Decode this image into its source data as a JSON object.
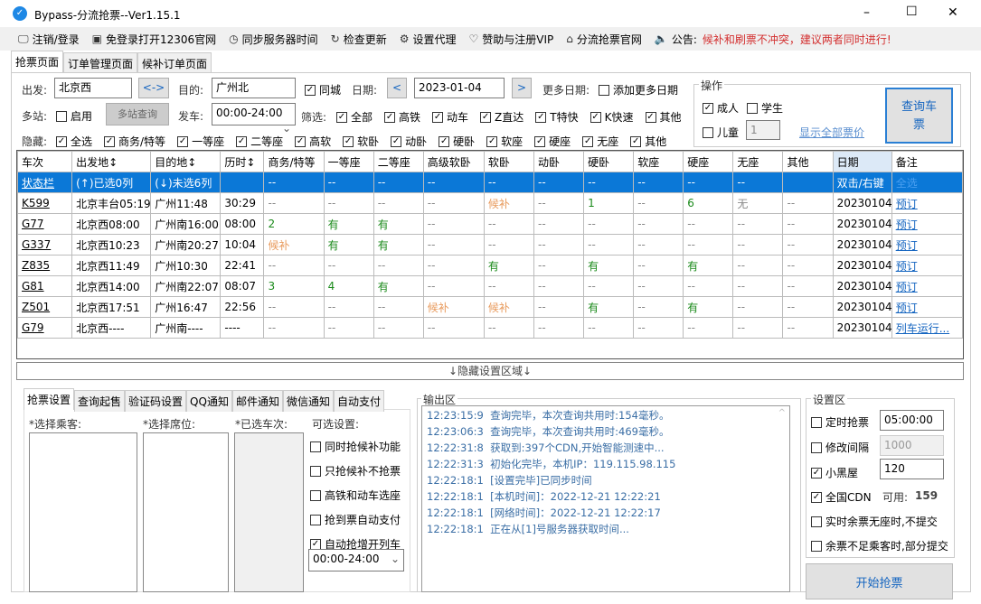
{
  "window": {
    "title": "Bypass-分流抢票--Ver1.15.1",
    "minimize": "–",
    "maximize": "☐",
    "close": "✕"
  },
  "menu": [
    {
      "icon": "monitor-icon",
      "glyph": "🖵",
      "label": "注销/登录"
    },
    {
      "icon": "browser-icon",
      "glyph": "▣",
      "label": "免登录打开12306官网"
    },
    {
      "icon": "clock-icon",
      "glyph": "◷",
      "label": "同步服务器时间"
    },
    {
      "icon": "refresh-icon",
      "glyph": "↻",
      "label": "检查更新"
    },
    {
      "icon": "gear-icon",
      "glyph": "⚙",
      "label": "设置代理"
    },
    {
      "icon": "heart-icon",
      "glyph": "♡",
      "label": "赞助与注册VIP"
    },
    {
      "icon": "home-icon",
      "glyph": "⌂",
      "label": "分流抢票官网"
    },
    {
      "icon": "speaker-icon",
      "glyph": "🔈",
      "label": "公告:"
    }
  ],
  "notice": "候补和刷票不冲突，建议两者同时进行!",
  "tabs": [
    "抢票页面",
    "订单管理页面",
    "候补订单页面"
  ],
  "search": {
    "from_label": "出发:",
    "from": "北京西",
    "swap": "<->",
    "to_label": "目的:",
    "to": "广州北",
    "same_city": "同城",
    "date_label": "日期:",
    "prev": "<",
    "date": "2023-01-04",
    "next": ">",
    "more_dates_label": "更多日期:",
    "add_dates": "添加更多日期",
    "multi_label": "多站:",
    "enable": "启用",
    "multi_query": "多站查询",
    "depart_label": "发车:",
    "depart_time": "00:00-24:00",
    "filter_label": "筛选:",
    "filters": [
      "全部",
      "高铁",
      "动车",
      "Z直达",
      "T特快",
      "K快速",
      "其他"
    ],
    "hide_label": "隐藏:",
    "hides": [
      "全选",
      "商务/特等",
      "一等座",
      "二等座",
      "高软",
      "软卧",
      "动卧",
      "硬卧",
      "软座",
      "硬座",
      "无座",
      "其他"
    ]
  },
  "ops": {
    "title": "操作",
    "adult": "成人",
    "student": "学生",
    "child": "儿童",
    "child_count": "1",
    "show_prices": "显示全部票价",
    "query": "查询车票"
  },
  "table": {
    "headers": [
      "车次",
      "出发地↕",
      "目的地↕",
      "历时↕",
      "商务/特等",
      "一等座",
      "二等座",
      "高级软卧",
      "软卧",
      "动卧",
      "硬卧",
      "软座",
      "硬座",
      "无座",
      "其他",
      "日期",
      "备注"
    ],
    "status_row": [
      "状态栏",
      "(↑)已选0列",
      "(↓)未选6列",
      "",
      "--",
      "--",
      "--",
      "--",
      "--",
      "--",
      "--",
      "--",
      "--",
      "--",
      "",
      "双击/右键",
      "全选"
    ],
    "rows": [
      [
        "K599",
        "北京丰台05:19",
        "广州11:48",
        "30:29",
        "--",
        "--",
        "--",
        "--",
        "候补",
        "--",
        "1",
        "--",
        "6",
        "无",
        "--",
        "20230104",
        "预订"
      ],
      [
        "G77",
        "北京西08:00",
        "广州南16:00",
        "08:00",
        "2",
        "有",
        "有",
        "--",
        "--",
        "--",
        "--",
        "--",
        "--",
        "--",
        "--",
        "20230104",
        "预订"
      ],
      [
        "G337",
        "北京西10:23",
        "广州南20:27",
        "10:04",
        "候补",
        "有",
        "有",
        "--",
        "--",
        "--",
        "--",
        "--",
        "--",
        "--",
        "--",
        "20230104",
        "预订"
      ],
      [
        "Z835",
        "北京西11:49",
        "广州10:30",
        "22:41",
        "--",
        "--",
        "--",
        "--",
        "有",
        "--",
        "有",
        "--",
        "有",
        "--",
        "--",
        "20230104",
        "预订"
      ],
      [
        "G81",
        "北京西14:00",
        "广州南22:07",
        "08:07",
        "3",
        "4",
        "有",
        "--",
        "--",
        "--",
        "--",
        "--",
        "--",
        "--",
        "--",
        "20230104",
        "预订"
      ],
      [
        "Z501",
        "北京西17:51",
        "广州16:47",
        "22:56",
        "--",
        "--",
        "--",
        "候补",
        "候补",
        "--",
        "有",
        "--",
        "有",
        "--",
        "--",
        "20230104",
        "预订"
      ],
      [
        "G79",
        "北京西----",
        "广州南----",
        "----",
        "--",
        "--",
        "--",
        "--",
        "--",
        "--",
        "--",
        "--",
        "--",
        "--",
        "--",
        "20230104",
        "列车运行..."
      ]
    ]
  },
  "hide_settings": "↓隐藏设置区域↓",
  "bottom_tabs": [
    "抢票设置",
    "查询起售",
    "验证码设置",
    "QQ通知",
    "邮件通知",
    "微信通知",
    "自动支付"
  ],
  "ticket_settings": {
    "passengers": "*选择乘客:",
    "seats": "*选择席位:",
    "selected_trains": "*已选车次:",
    "optional": "可选设置:",
    "options": [
      {
        "label": "同时抢候补功能",
        "checked": false
      },
      {
        "label": "只抢候补不抢票",
        "checked": false
      },
      {
        "label": "高铁和动车选座",
        "checked": false
      },
      {
        "label": "抢到票自动支付",
        "checked": false
      },
      {
        "label": "自动抢增开列车",
        "checked": true
      }
    ],
    "time_range": "00:00-24:00"
  },
  "output": {
    "title": "输出区",
    "lines": [
      "12:23:15:9  查询完毕，本次查询共用时:154毫秒。",
      "12:23:06:3  查询完毕，本次查询共用时:469毫秒。",
      "12:22:31:8  获取到:397个CDN,开始智能测速中...",
      "12:22:31:3  初始化完毕，本机IP：119.115.98.115",
      "12:22:18:1  [设置完毕]已同步时间",
      "12:22:18:1  [本机时间]：2022-12-21 12:22:21",
      "12:22:18:1  [网络时间]：2022-12-21 12:22:17",
      "12:22:18:1  正在从[1]号服务器获取时间..."
    ]
  },
  "settings": {
    "title": "设置区",
    "timed": "定时抢票",
    "timed_value": "05:00:00",
    "interval": "修改间隔",
    "interval_value": "1000",
    "blackroom": "小黑屋",
    "blackroom_value": "120",
    "cdn": "全国CDN",
    "cdn_avail_label": "可用:",
    "cdn_avail": "159",
    "no_seat": "实时余票无座时,不提交",
    "partial": "余票不足乘客时,部分提交",
    "start": "开始抢票"
  }
}
